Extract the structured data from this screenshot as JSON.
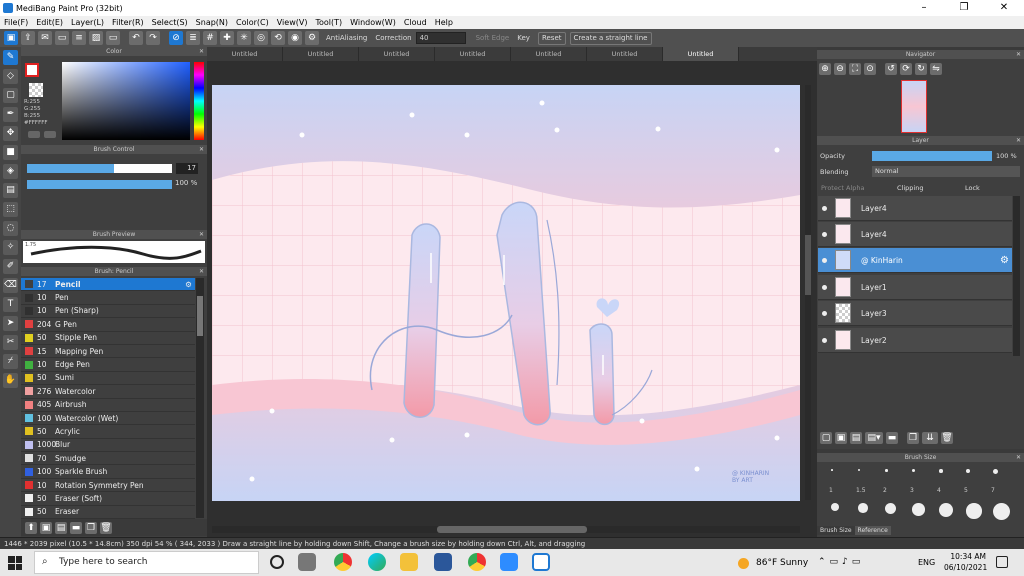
{
  "window": {
    "title": "MediBang Paint Pro (32bit)",
    "min": "–",
    "max": "❐",
    "close": "✕"
  },
  "menu": [
    "File(F)",
    "Edit(E)",
    "Layer(L)",
    "Filter(R)",
    "Select(S)",
    "Snap(N)",
    "Color(C)",
    "View(V)",
    "Tool(T)",
    "Window(W)",
    "Cloud",
    "Help"
  ],
  "toolbar": {
    "antialias": "AntiAliasing",
    "correction_label": "Correction",
    "correction_value": "40",
    "soft_edge": "Soft Edge",
    "key": "Key",
    "reset": "Reset",
    "straight_line": "Create a straight line"
  },
  "color_panel": {
    "title": "Color",
    "r": "R:255",
    "g": "G:255",
    "b": "B:255",
    "hex": "#FFFFFF"
  },
  "brush_control": {
    "title": "Brush Control",
    "size": "17",
    "opacity": "100 %",
    "size_fraction": 0.6
  },
  "brush_preview": {
    "title": "Brush Preview",
    "size": "1.75"
  },
  "brush_list": {
    "title": "Brush: Pencil",
    "items": [
      {
        "size": "17",
        "name": "Pencil",
        "color": "#404040"
      },
      {
        "size": "10",
        "name": "Pen",
        "color": "#303030"
      },
      {
        "size": "10",
        "name": "Pen (Sharp)",
        "color": "#303030"
      },
      {
        "size": "204",
        "name": "G Pen",
        "color": "#e04040"
      },
      {
        "size": "50",
        "name": "Stipple Pen",
        "color": "#e0d020"
      },
      {
        "size": "15",
        "name": "Mapping Pen",
        "color": "#e04040"
      },
      {
        "size": "10",
        "name": "Edge Pen",
        "color": "#40b040"
      },
      {
        "size": "50",
        "name": "Sumi",
        "color": "#e0c020"
      },
      {
        "size": "276",
        "name": "Watercolor",
        "color": "#f0a0a0"
      },
      {
        "size": "405",
        "name": "Airbrush",
        "color": "#f08080"
      },
      {
        "size": "100",
        "name": "Watercolor (Wet)",
        "color": "#60c0e0"
      },
      {
        "size": "50",
        "name": "Acrylic",
        "color": "#e0c020"
      },
      {
        "size": "1000",
        "name": "Blur",
        "color": "#c0c0f0"
      },
      {
        "size": "70",
        "name": "Smudge",
        "color": "#e0e0e0"
      },
      {
        "size": "100",
        "name": "Sparkle Brush",
        "color": "#3060e0"
      },
      {
        "size": "10",
        "name": "Rotation Symmetry Pen",
        "color": "#e03030"
      },
      {
        "size": "50",
        "name": "Eraser (Soft)",
        "color": "#f0f0f0"
      },
      {
        "size": "50",
        "name": "Eraser",
        "color": "#f0f0f0"
      }
    ]
  },
  "doc_tabs": [
    "Untitled",
    "Untitled",
    "Untitled",
    "Untitled",
    "Untitled",
    "Untitled",
    "Untitled"
  ],
  "navigator": {
    "title": "Navigator"
  },
  "layer_panel": {
    "title": "Layer",
    "opacity_label": "Opacity",
    "opacity_value": "100 %",
    "blending_label": "Blending",
    "blending_value": "Normal",
    "protect_alpha": "Protect Alpha",
    "clipping": "Clipping",
    "lock": "Lock",
    "layers": [
      "Layer4",
      "Layer4",
      "@ KinHarin",
      "Layer1",
      "Layer3",
      "Layer2"
    ]
  },
  "brush_size_panel": {
    "title": "Brush Size",
    "sizes": [
      "1",
      "1.5",
      "2",
      "3",
      "4",
      "5",
      "7"
    ],
    "tabs": [
      "Brush Size",
      "Reference"
    ]
  },
  "canvas": {
    "watermark": "@ KINHARIN\nBY ART"
  },
  "status": "1446 * 2039 pixel   (10.5 * 14.8cm)   350 dpi   54 %   ( 344, 2033 )   Draw a straight line by holding down Shift, Change a brush size by holding down Ctrl, Alt, and dragging",
  "taskbar": {
    "search": "Type here to search",
    "weather": "86°F  Sunny",
    "lang": "ENG",
    "time": "10:34 AM",
    "date": "06/10/2021"
  }
}
